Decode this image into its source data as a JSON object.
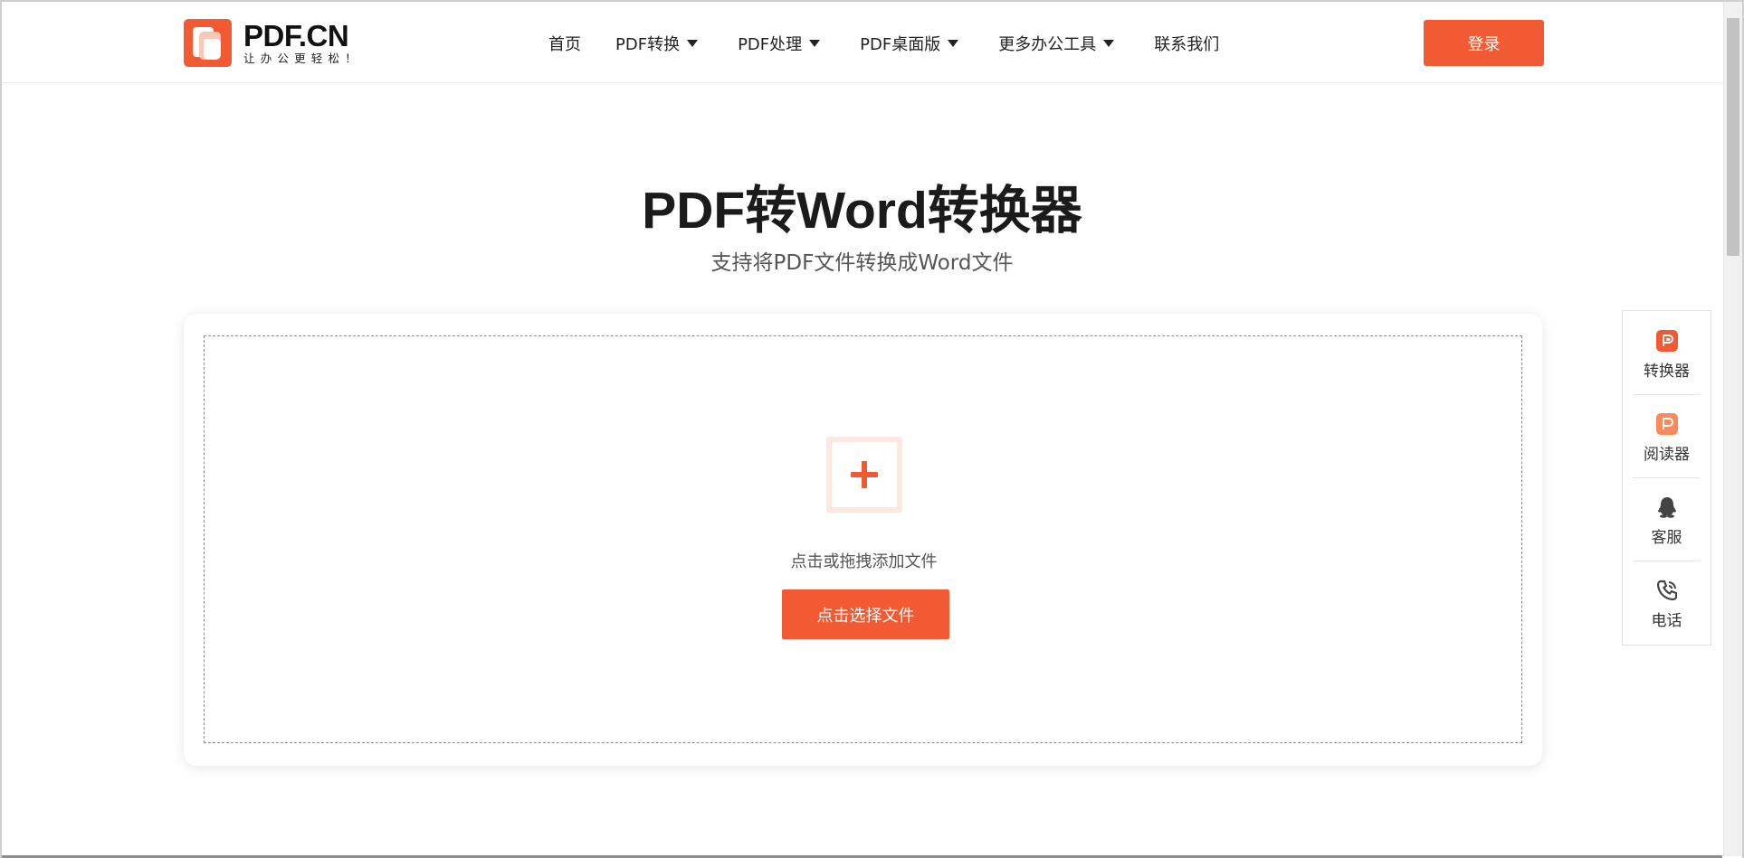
{
  "brand": {
    "name": "PDF.CN",
    "slogan": "让办公更轻松！",
    "color": "#f15a32"
  },
  "nav": {
    "items": [
      {
        "label": "首页",
        "has_dropdown": false
      },
      {
        "label": "PDF转换",
        "has_dropdown": true
      },
      {
        "label": "PDF处理",
        "has_dropdown": true
      },
      {
        "label": "PDF桌面版",
        "has_dropdown": true
      },
      {
        "label": "更多办公工具",
        "has_dropdown": true
      },
      {
        "label": "联系我们",
        "has_dropdown": false
      }
    ],
    "login_label": "登录"
  },
  "hero": {
    "title": "PDF转Word转换器",
    "subtitle": "支持将PDF文件转换成Word文件"
  },
  "upload": {
    "add_icon": "plus-icon",
    "hint": "点击或拖拽添加文件",
    "button_label": "点击选择文件"
  },
  "sidebar": {
    "items": [
      {
        "label": "转换器",
        "icon": "converter-icon"
      },
      {
        "label": "阅读器",
        "icon": "reader-icon"
      },
      {
        "label": "客服",
        "icon": "qq-penguin-icon"
      },
      {
        "label": "电话",
        "icon": "phone-icon"
      }
    ]
  }
}
